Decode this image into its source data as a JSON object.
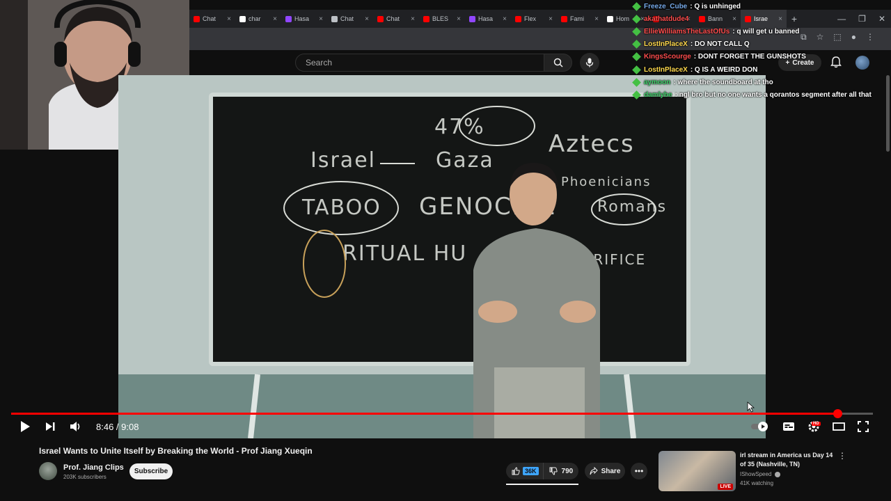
{
  "browser": {
    "tabs": [
      {
        "label": "Chat",
        "color": "#ff0000"
      },
      {
        "label": "char",
        "color": "#ffffff"
      },
      {
        "label": "Hasa",
        "color": "#9146ff"
      },
      {
        "label": "Chat",
        "color": "#bdc1c6"
      },
      {
        "label": "Chat",
        "color": "#ff0000"
      },
      {
        "label": "BLES",
        "color": "#ff0000"
      },
      {
        "label": "Hasa",
        "color": "#9146ff"
      },
      {
        "label": "Flex",
        "color": "#ff0000"
      },
      {
        "label": "Fami",
        "color": "#ff0000"
      },
      {
        "label": "Hom",
        "color": "#ffffff"
      },
      {
        "label": "",
        "color": "#ff0000"
      },
      {
        "label": "Bann",
        "color": "#ff0000"
      },
      {
        "label": "Israe",
        "color": "#ff0000",
        "active": true
      }
    ],
    "new_tab": "+"
  },
  "youtube": {
    "search_placeholder": "Search",
    "create_label": "Create",
    "player": {
      "time": "8:46 / 9:08",
      "progress": 0.9588
    },
    "video": {
      "title": "Israel Wants to Unite Itself by Breaking the World - Prof Jiang Xueqin",
      "channel_name": "Prof. Jiang Clips",
      "subscribers": "203K subscribers",
      "subscribe_label": "Subscribe",
      "likes": "36K",
      "dislikes": "790",
      "share_label": "Share"
    },
    "board_words": [
      "47%",
      "Israel",
      "Gaza",
      "Aztecs",
      "Phoenicians",
      "TABOO",
      "GENOCIDE",
      "Romans",
      "RITUAL HU",
      "SACRIFICE"
    ],
    "recommendation": {
      "title": "irl stream in America us Day 14 of 35 (Nashville, TN)",
      "channel": "IShowSpeed",
      "viewers": "41K watching",
      "live_label": "LIVE"
    }
  },
  "chat": [
    {
      "user": "Freeze_Cube",
      "msg": ": Q is unhinged",
      "color": "#76a9e8"
    },
    {
      "user": "akathatdude4",
      "msg": "",
      "color": "#ff4d4d"
    },
    {
      "user": "EllieWilliamsTheLastOfUs",
      "msg": ": q will get u banned",
      "color": "#ff4d4d"
    },
    {
      "user": "LostInPlaceX",
      "msg": ": DO NOT CALL Q",
      "color": "#ffd94d"
    },
    {
      "user": "KingsScourge",
      "msg": ": DONT FORGET THE GUNSHOTS",
      "color": "#ff4d4d"
    },
    {
      "user": "LostInPlaceX",
      "msg": ": Q IS A WEIRD DON",
      "color": "#ffd94d"
    },
    {
      "user": "aymoon",
      "msg": ": where the soundboard at tho",
      "color": "#3ed36b"
    },
    {
      "user": "damlybe",
      "msg": ": ngl bro but no one wants a qorantos segment after all that",
      "color": "#3ed36b"
    }
  ]
}
